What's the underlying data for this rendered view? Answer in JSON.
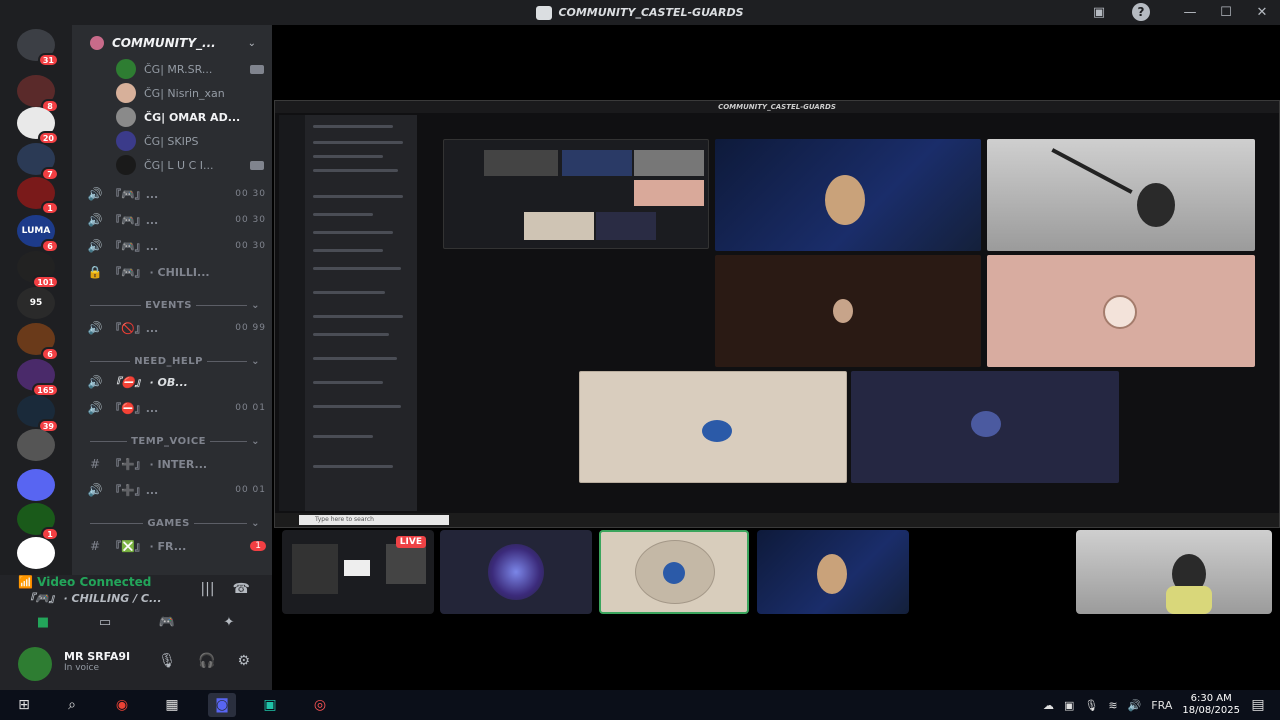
{
  "window": {
    "title": "COMMUNITY_CASTEL-GUARDS",
    "controls": [
      "—",
      "☐",
      "✕"
    ]
  },
  "rail": {
    "servers": [
      {
        "badge": "31",
        "color": "#3c3f45"
      },
      {
        "badge": "8",
        "color": "#5a2a2a"
      },
      {
        "badge": "20",
        "color": "#e9e9e9"
      },
      {
        "badge": "7",
        "color": "#2b3a55"
      },
      {
        "badge": "1",
        "color": "#7a1a1a"
      },
      {
        "badge": "6",
        "color": "#1d3b8a",
        "label": "LUMA"
      },
      {
        "badge": "101",
        "color": "#222"
      },
      {
        "badge": "",
        "color": "#2a2a2a",
        "label": "95"
      },
      {
        "badge": "6",
        "color": "#6a3a1a"
      },
      {
        "badge": "165",
        "color": "#4a2a6a"
      },
      {
        "badge": "39",
        "color": "#1a2a3a"
      },
      {
        "badge": "",
        "color": "#555"
      },
      {
        "badge": "",
        "color": "#5865f2"
      },
      {
        "badge": "1",
        "color": "#1a5a1a"
      },
      {
        "badge": "",
        "color": "#ffffff"
      }
    ]
  },
  "sidebar": {
    "guild_name": "COMMUNITY_...",
    "voice_users": [
      {
        "name": "ČG| MR.SR...",
        "avatar": "#2e7d32",
        "bold": false,
        "cam": true
      },
      {
        "name": "ČG| Nisrin_xan",
        "avatar": "#d7b09a",
        "bold": false,
        "cam": false
      },
      {
        "name": "ČG| OMAR AD...",
        "avatar": "#8a8a8a",
        "bold": true,
        "cam": false
      },
      {
        "name": "ČG| SKIPS",
        "avatar": "#3b3b8a",
        "bold": false,
        "cam": false
      },
      {
        "name": "ČG| L U C I...",
        "avatar": "#1a1a1a",
        "bold": false,
        "cam": true
      }
    ],
    "channels": [
      {
        "icon": "🔊",
        "name": "『🎮』...",
        "count": "00 30"
      },
      {
        "icon": "🔊",
        "name": "『🎮』...",
        "count": "00 30"
      },
      {
        "icon": "🔊",
        "name": "『🎮』...",
        "count": "00 30"
      },
      {
        "icon": "🔒",
        "name": "『🎮』 · CHILLI...",
        "count": ""
      }
    ],
    "cat_events": "EVENTS",
    "events_channels": [
      {
        "icon": "🔊",
        "name": "『🚫』...",
        "count": "00 99"
      }
    ],
    "cat_help": "NEED_HELP",
    "help_channels": [
      {
        "icon": "🔊",
        "name": "『⛔』 · OB...",
        "count": "",
        "hl": true
      },
      {
        "icon": "🔊",
        "name": "『⛔』...",
        "count": "00 01"
      }
    ],
    "cat_temp": "TEMP_VOICE",
    "temp_channels": [
      {
        "icon": "#",
        "name": "『➕』 · INTER...",
        "count": ""
      },
      {
        "icon": "🔊",
        "name": "『➕』...",
        "count": "00 01"
      }
    ],
    "cat_games": "GAMES",
    "games_channels": [
      {
        "icon": "#",
        "name": "『❎』 · FR...",
        "count": "1"
      }
    ]
  },
  "voice_panel": {
    "status": "Video Connected",
    "channel": "『🎮』 · CHILLING / C..."
  },
  "user_panel": {
    "name": "MR SRFA9I",
    "status": "In voice"
  },
  "share": {
    "inner_title": "COMMUNITY_CASTEL-GUARDS",
    "search_placeholder": "Type here to search"
  },
  "thumbs": {
    "live_label": "LIVE"
  },
  "taskbar": {
    "lang": "FRA",
    "time": "6:30 AM",
    "date": "18/08/2025"
  }
}
